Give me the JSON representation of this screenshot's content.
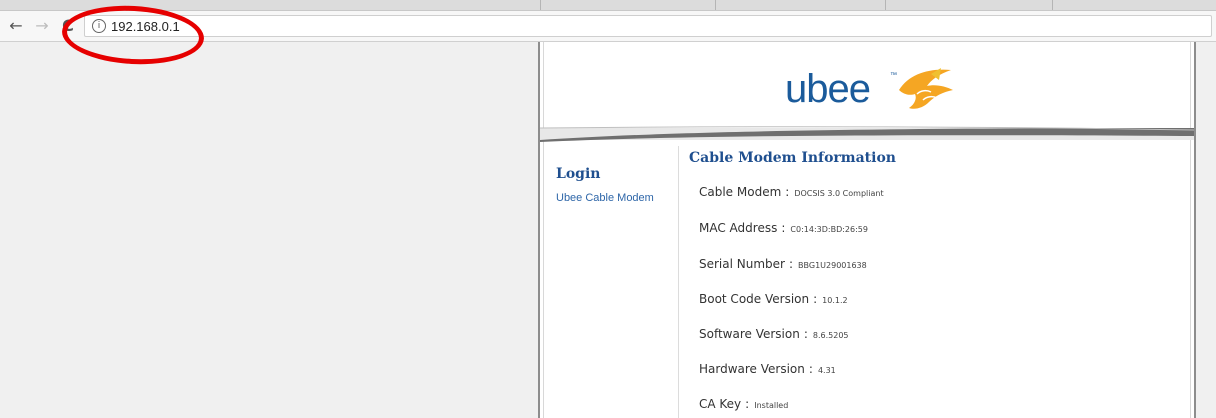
{
  "browser": {
    "back_glyph": "←",
    "forward_glyph": "→",
    "reload_glyph": "C",
    "info_glyph": "i",
    "url": "192.168.0.1"
  },
  "logo": {
    "text": "ubee",
    "tm": "™",
    "brand_blue": "#1b5b9b",
    "fish_color": "#f5a623"
  },
  "sidebar": {
    "title": "Login",
    "link": "Ubee Cable Modem"
  },
  "info": {
    "title": "Cable Modem Information",
    "separator": ":",
    "rows": [
      {
        "label": "Cable Modem",
        "value": "DOCSIS 3.0 Compliant"
      },
      {
        "label": "MAC Address",
        "value": "C0:14:3D:BD:26:59"
      },
      {
        "label": "Serial Number",
        "value": "BBG1U29001638"
      },
      {
        "label": "Boot Code Version",
        "value": "10.1.2"
      },
      {
        "label": "Software Version",
        "value": "8.6.5205"
      },
      {
        "label": "Hardware Version",
        "value": "4.31"
      },
      {
        "label": "CA Key",
        "value": "Installed"
      }
    ]
  },
  "annotation": {
    "color": "#e60000"
  }
}
